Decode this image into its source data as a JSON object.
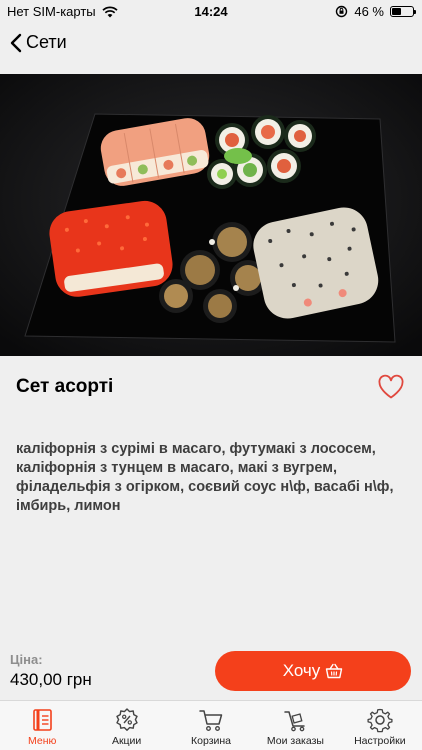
{
  "status_bar": {
    "carrier": "Нет SIM-карты",
    "time": "14:24",
    "battery": "46 %",
    "battery_level": 0.46
  },
  "nav": {
    "back_label": "Сети"
  },
  "product": {
    "title": "Сет асорті",
    "description": "каліфорнія з сурімі в масаго, футумакі з лососем, каліфорнія з тунцем в масаго, макі з вугрем, філадельфія з огірком, соєвий соус н\\ф, васабі н\\ф, імбирь, лимон",
    "price_label": "Ціна:",
    "price": "430,00 грн",
    "cta_label": "Хочу"
  },
  "tabbar": {
    "items": [
      {
        "label": "Меню",
        "icon": "menu-book-icon",
        "active": true
      },
      {
        "label": "Акции",
        "icon": "discount-gear-icon",
        "active": false
      },
      {
        "label": "Корзина",
        "icon": "cart-icon",
        "active": false
      },
      {
        "label": "Мои заказы",
        "icon": "delivery-cart-icon",
        "active": false
      },
      {
        "label": "Настройки",
        "icon": "gear-icon",
        "active": false
      }
    ]
  },
  "colors": {
    "accent": "#f4401b",
    "background": "#efefef",
    "favorite": "#e0483e"
  }
}
